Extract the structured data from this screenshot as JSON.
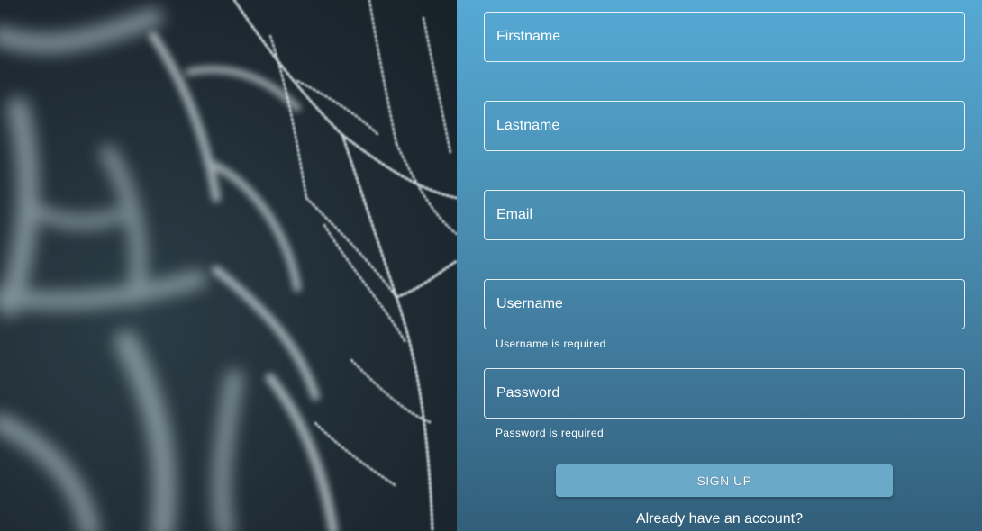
{
  "form": {
    "firstname_placeholder": "Firstname",
    "lastname_placeholder": "Lastname",
    "email_placeholder": "Email",
    "username_placeholder": "Username",
    "username_error": "Username is required",
    "password_placeholder": "Password",
    "password_error": "Password is required",
    "signup_label": "SIGN UP",
    "login_link": "Already have an account?"
  },
  "colors": {
    "panel_top": "#55a9d4",
    "panel_bottom": "#325f7a",
    "button": "#6aa9c8",
    "text": "#ffffff"
  }
}
